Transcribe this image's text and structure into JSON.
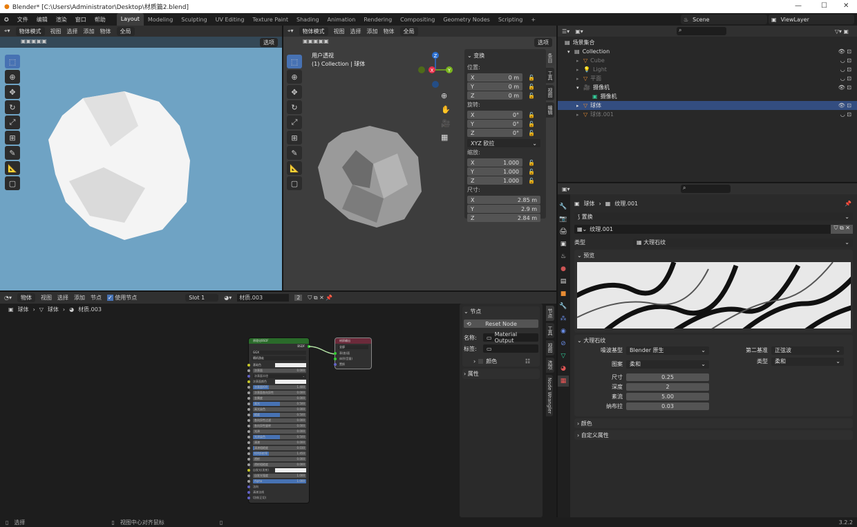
{
  "window": {
    "title": "Blender* [C:\\Users\\Administrator\\Desktop\\材质篇2.blend]",
    "minimize": "—",
    "maximize": "☐",
    "close": "✕"
  },
  "menu": [
    "文件",
    "编辑",
    "渲染",
    "窗口",
    "帮助"
  ],
  "workspaces": [
    "Layout",
    "Modeling",
    "Sculpting",
    "UV Editing",
    "Texture Paint",
    "Shading",
    "Animation",
    "Rendering",
    "Compositing",
    "Geometry Nodes",
    "Scripting",
    "+"
  ],
  "active_workspace": "Layout",
  "scene": {
    "name": "Scene",
    "view_layer": "ViewLayer"
  },
  "viewport_left": {
    "mode": "物体模式",
    "menus": [
      "视图",
      "选择",
      "添加",
      "物体"
    ],
    "transform": "全局",
    "select_label": "选项",
    "bg": "#6fa3c4"
  },
  "viewport_right": {
    "mode": "物体模式",
    "menus": [
      "视图",
      "选择",
      "添加",
      "物体"
    ],
    "transform": "全局",
    "select_label": "选项",
    "view_name": "用户透视",
    "collection_info": "(1) Collection | 球体",
    "gizmo": {
      "x": "X",
      "y": "Y",
      "z": "Z"
    }
  },
  "npanel_transform": {
    "title": "变换",
    "location_label": "位置:",
    "location": [
      "0 m",
      "0 m",
      "0 m"
    ],
    "rotation_label": "旋转:",
    "rotation": [
      "0°",
      "0°",
      "0°"
    ],
    "rotation_mode": "XYZ 欧拉",
    "scale_label": "缩放:",
    "scale": [
      "1.000",
      "1.000",
      "1.000"
    ],
    "dimensions_label": "尺寸:",
    "dimensions": [
      "2.85 m",
      "2.9 m",
      "2.84 m"
    ],
    "axes": [
      "X",
      "Y",
      "Z"
    ],
    "tabs": [
      "条目",
      "工具",
      "视图",
      "编辑"
    ]
  },
  "outliner": {
    "root": "场景集合",
    "items": [
      {
        "name": "Collection",
        "level": 0,
        "expanded": true,
        "icon": "collection-icon",
        "dim": false,
        "selected": false
      },
      {
        "name": "Cube",
        "level": 1,
        "icon": "mesh-icon",
        "dim": true,
        "selected": false
      },
      {
        "name": "Light",
        "level": 1,
        "icon": "light-icon",
        "dim": true,
        "selected": false
      },
      {
        "name": "平面",
        "level": 1,
        "icon": "mesh-icon",
        "dim": true,
        "selected": false
      },
      {
        "name": "摄像机",
        "level": 1,
        "icon": "camera-icon",
        "dim": false,
        "selected": false,
        "expanded": true
      },
      {
        "name": "摄像机",
        "level": 2,
        "icon": "camera-data-icon",
        "dim": false,
        "selected": false
      },
      {
        "name": "球体",
        "level": 1,
        "icon": "mesh-icon",
        "dim": false,
        "selected": true
      },
      {
        "name": "球体.001",
        "level": 1,
        "icon": "mesh-icon",
        "dim": true,
        "selected": false
      }
    ]
  },
  "properties": {
    "breadcrumb": [
      "球体",
      "纹理.001"
    ],
    "texture_slot": "置换",
    "texture_name": "纹理.001",
    "type_label": "类型",
    "type_value": "大理石纹",
    "preview_label": "预览",
    "marble": {
      "title": "大理石纹",
      "noise_basis_label": "噪波基型",
      "noise_basis": "Blender 原生",
      "pattern_label": "图案",
      "pattern": "柔和",
      "second_basis_label": "第二基准",
      "second_basis": "正弦波",
      "type_label": "类型",
      "type": "柔和",
      "size_label": "尺寸",
      "size": "0.25",
      "depth_label": "深度",
      "depth": "2",
      "turbulence_label": "紊流",
      "turbulence": "5.00",
      "nabla_label": "纳布拉",
      "nabla": "0.03"
    },
    "color_panel": "颜色",
    "custom_props": "自定义属性"
  },
  "node_editor": {
    "type": "物体",
    "menus": [
      "视图",
      "选择",
      "添加",
      "节点"
    ],
    "use_nodes": "使用节点",
    "slot": "Slot 1",
    "material": "材质.003",
    "users": "2",
    "breadcrumb": [
      "球体",
      "球体",
      "材质.003"
    ],
    "bsdf": {
      "title": "原理化BSDF",
      "output": "BSDF",
      "distribution": "GGX",
      "subsurface_method": "随机游走",
      "inputs": [
        {
          "name": "基础色",
          "kind": "color",
          "value": ""
        },
        {
          "name": "次表面",
          "kind": "num",
          "value": "0.000",
          "fill": 0
        },
        {
          "name": "次表面半径",
          "kind": "vec",
          "value": ""
        },
        {
          "name": "次表面颜色",
          "kind": "color",
          "value": ""
        },
        {
          "name": "次表面IOR",
          "kind": "num",
          "value": "1.400",
          "fill": 0.3
        },
        {
          "name": "次表面各向异性",
          "kind": "num",
          "value": "0.000",
          "fill": 0
        },
        {
          "name": "金属度",
          "kind": "num",
          "value": "0.000",
          "fill": 0
        },
        {
          "name": "高光",
          "kind": "num",
          "value": "0.500",
          "fill": 0.5
        },
        {
          "name": "高光染色",
          "kind": "num",
          "value": "0.000",
          "fill": 0
        },
        {
          "name": "糙度",
          "kind": "num",
          "value": "0.500",
          "fill": 0.5
        },
        {
          "name": "各向异性过滤",
          "kind": "num",
          "value": "0.000",
          "fill": 0
        },
        {
          "name": "各向异性旋转",
          "kind": "num",
          "value": "0.000",
          "fill": 0
        },
        {
          "name": "光泽",
          "kind": "num",
          "value": "0.000",
          "fill": 0
        },
        {
          "name": "光泽染色",
          "kind": "num",
          "value": "0.500",
          "fill": 0.5
        },
        {
          "name": "清漆",
          "kind": "num",
          "value": "0.000",
          "fill": 0
        },
        {
          "name": "清漆粗糙度",
          "kind": "num",
          "value": "0.030",
          "fill": 0.03
        },
        {
          "name": "IOR折射率",
          "kind": "num",
          "value": "1.450",
          "fill": 0.3
        },
        {
          "name": "透射",
          "kind": "num",
          "value": "0.000",
          "fill": 0
        },
        {
          "name": "透射粗糙度",
          "kind": "num",
          "value": "0.000",
          "fill": 0
        },
        {
          "name": "自发光(发射)",
          "kind": "color",
          "value": ""
        },
        {
          "name": "自发光强度",
          "kind": "num",
          "value": "1.000",
          "fill": 0
        },
        {
          "name": "Alpha",
          "kind": "num",
          "value": "1.000",
          "fill": 1
        },
        {
          "name": "法向",
          "kind": "plain",
          "value": ""
        },
        {
          "name": "清漆法线",
          "kind": "plain",
          "value": ""
        },
        {
          "name": "切线(正切)",
          "kind": "plain",
          "value": ""
        }
      ]
    },
    "output": {
      "title": "材质输出",
      "target": "全部",
      "inputs": [
        "表(曲)面",
        "体积(音量)",
        "置换"
      ]
    }
  },
  "node_npanel": {
    "title": "节点",
    "reset": "Reset Node",
    "name_label": "名称:",
    "name": "Material Output",
    "label_label": "标签:",
    "label": "",
    "color": "颜色",
    "properties": "属性",
    "tabs": [
      "节点",
      "工具",
      "视图",
      "选项",
      "Node Wrangler"
    ]
  },
  "status": {
    "left": "选择",
    "middle": "视图中心对齐鼠标",
    "version": "3.2.2"
  },
  "colors": {
    "accent": "#4772b3",
    "selected_row": "#334d80",
    "header": "#303030",
    "viewport": "#3d3d3d"
  }
}
